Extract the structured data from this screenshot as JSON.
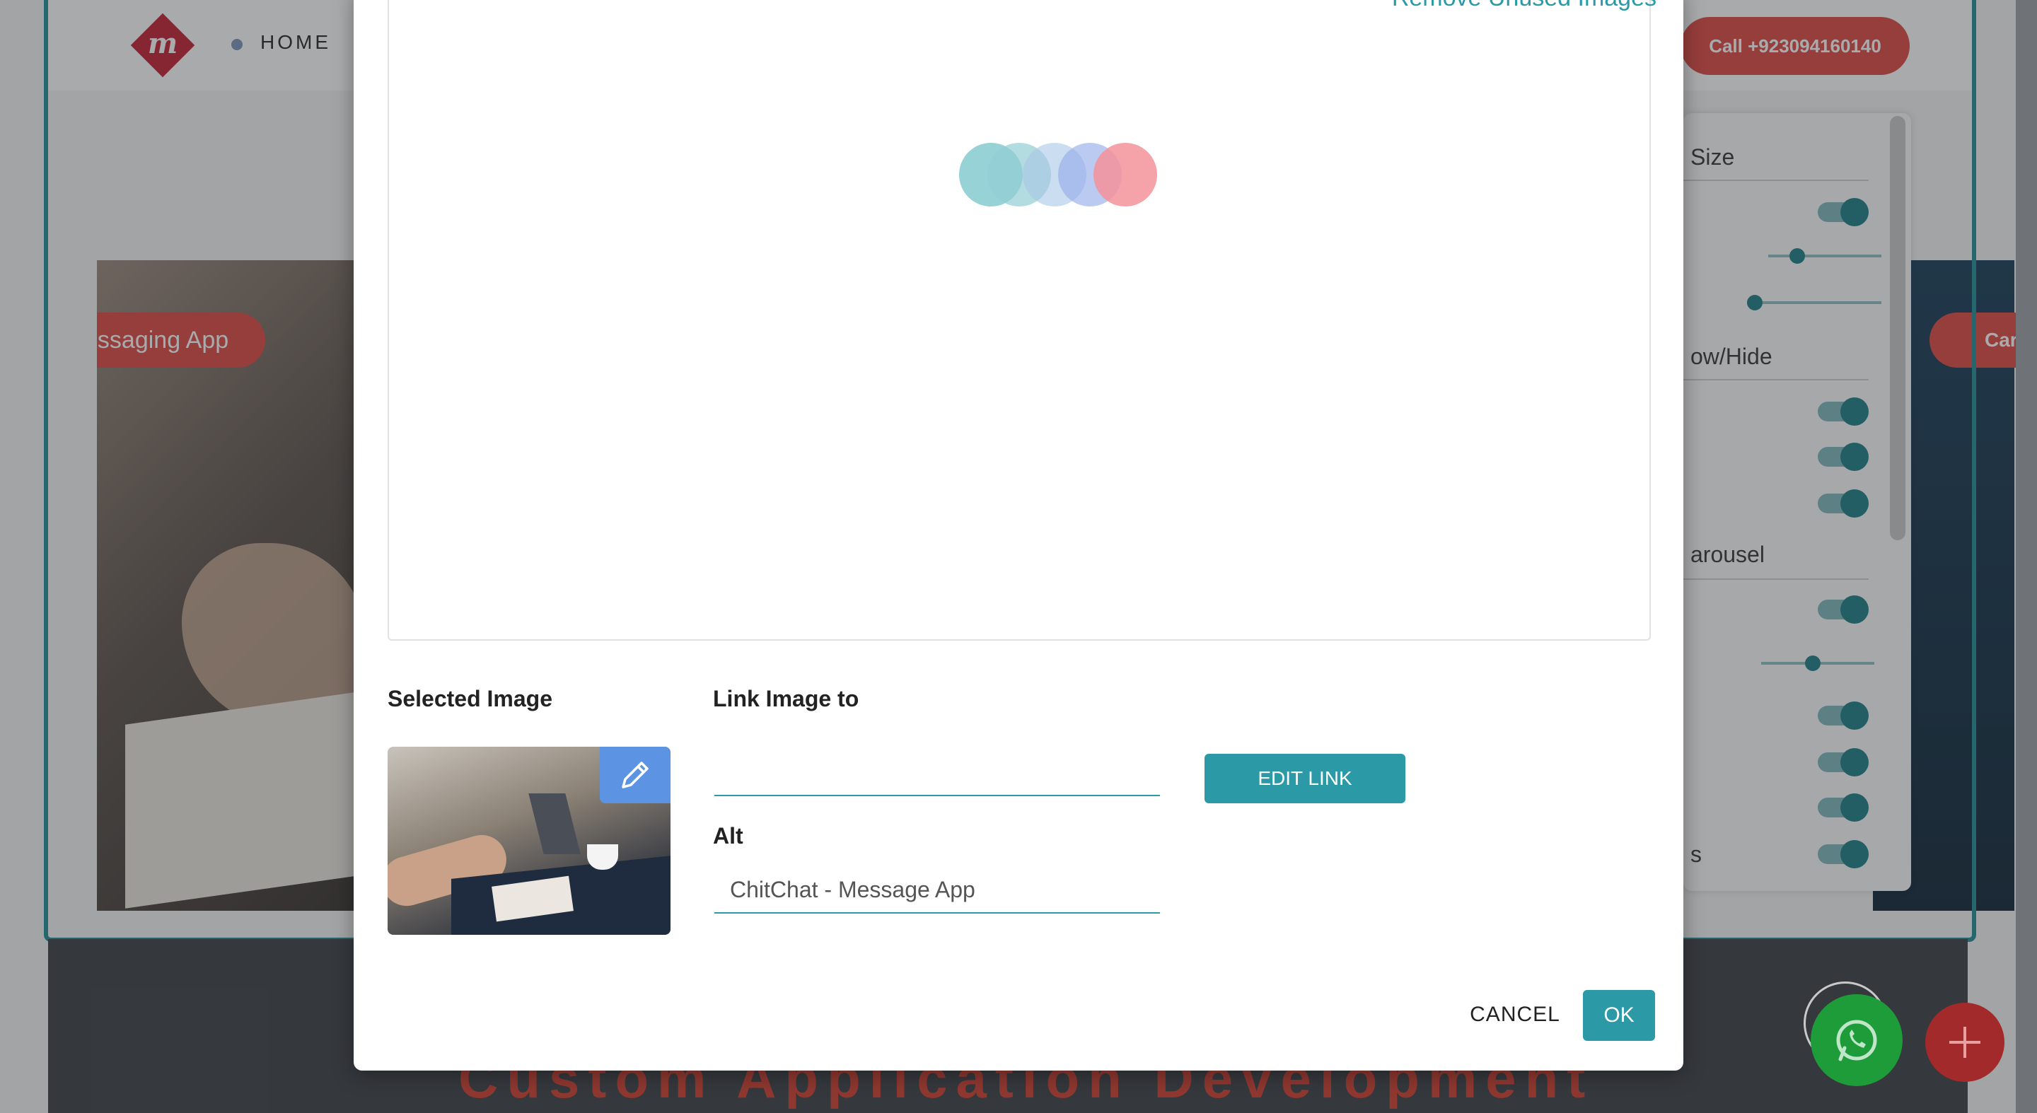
{
  "site": {
    "nav_home": "HOME",
    "call_label": "Call +923094160140",
    "slide_left_label": "essaging App",
    "slide_right_label": "Car",
    "bottom_title": "Custom Application Development"
  },
  "settings_panel": {
    "labels": [
      "Size",
      "ow/Hide",
      "arousel",
      "s"
    ],
    "toggles_on": [
      true,
      true,
      true,
      true,
      true,
      true,
      true,
      true,
      true
    ],
    "slider_levels": [
      0.2,
      0.05,
      0.4
    ]
  },
  "modal": {
    "remove_unused_label": "Remove Unused Images",
    "selected_image_title": "Selected Image",
    "link_image_title": "Link Image to",
    "link_value": "",
    "edit_link_label": "EDIT LINK",
    "alt_title": "Alt",
    "alt_value": "ChitChat - Message App",
    "cancel_label": "CANCEL",
    "ok_label": "OK"
  },
  "loader": {
    "colors": [
      "#7cc7cc",
      "#93cdd4",
      "#a9c6e6",
      "#96aeea",
      "#f4929a"
    ]
  },
  "colors": {
    "accent": "#2b9aa6",
    "brand_red": "#c51d2f",
    "call_red": "#e0453e",
    "edit_image_blue": "#5d93e3",
    "whatsapp_green": "#1e9c3a"
  },
  "icons": {
    "edit_image": "pencil-icon",
    "whatsapp": "whatsapp-icon",
    "add": "plus-icon"
  }
}
